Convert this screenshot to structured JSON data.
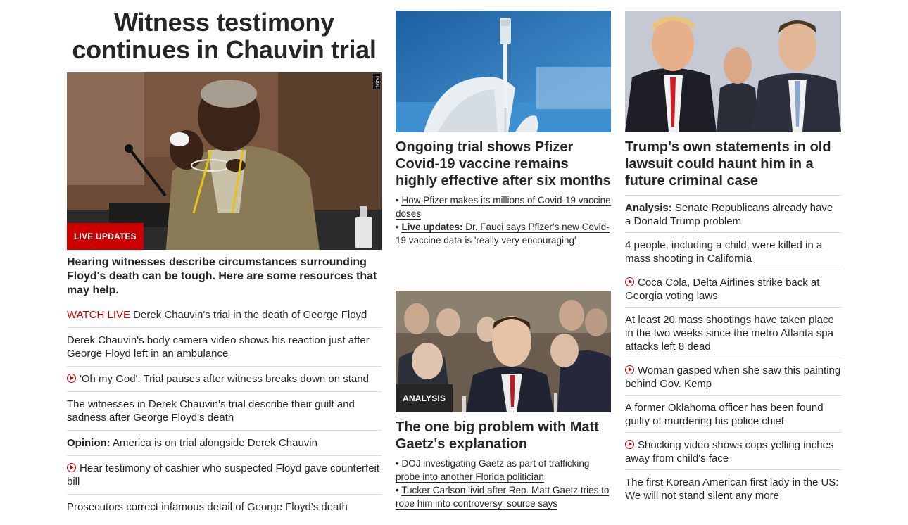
{
  "lead": {
    "title": "Witness testimony continues in Chauvin trial",
    "badge": "LIVE UPDATES",
    "pool_mark": "POOL",
    "subhead": "Hearing witnesses describe circumstances surrounding Floyd's death can be tough. Here are some resources that may help.",
    "items": [
      {
        "prefix": "WATCH LIVE",
        "text": " Derek Chauvin's trial in the death of George Floyd"
      },
      {
        "text": "Derek Chauvin's body camera video shows his reaction just after George Floyd left in an ambulance"
      },
      {
        "video": true,
        "text": "'Oh my God': Trial pauses after witness breaks down on stand"
      },
      {
        "text": "The witnesses in Derek Chauvin's trial describe their guilt and sadness after George Floyd's death"
      },
      {
        "prefix_bold": "Opinion:",
        "text": " America is on trial alongside Derek Chauvin"
      },
      {
        "video": true,
        "text": "Hear testimony of cashier who suspected Floyd gave counterfeit bill"
      },
      {
        "text": "Prosecutors correct infamous detail of George Floyd's death"
      }
    ]
  },
  "pfizer": {
    "headline": "Ongoing trial shows Pfizer Covid-19 vaccine remains highly effective after six months",
    "bullets": [
      {
        "prefix": "• ",
        "text": "How Pfizer makes its millions of Covid-19 vaccine doses"
      },
      {
        "prefix": "• ",
        "bold": "Live updates:",
        "text": " Dr. Fauci says Pfizer's new Covid-19 vaccine data is 'really very encouraging'"
      }
    ]
  },
  "gaetz": {
    "badge": "ANALYSIS",
    "headline": "The one big problem with Matt Gaetz's explanation",
    "bullets": [
      {
        "prefix": "• ",
        "text": "DOJ investigating Gaetz as part of trafficking probe into another Florida politician"
      },
      {
        "prefix": "• ",
        "text": "Tucker Carlson livid after Rep. Matt Gaetz tries to rope him into controversy, source says"
      }
    ]
  },
  "trump": {
    "headline": "Trump's own statements in old lawsuit could haunt him in a future criminal case",
    "items": [
      {
        "prefix_bold": "Analysis:",
        "text": " Senate Republicans already have a Donald Trump problem"
      },
      {
        "text": "4 people, including a child, were killed in a mass shooting in California"
      },
      {
        "video": true,
        "text": "Coca Cola, Delta Airlines strike back at Georgia voting laws"
      },
      {
        "text": "At least 20 mass shootings have taken place in the two weeks since the metro Atlanta spa attacks left 8 dead"
      },
      {
        "video": true,
        "text": "Woman gasped when she saw this painting behind Gov. Kemp"
      },
      {
        "text": "A former Oklahoma officer has been found guilty of murdering his police chief"
      },
      {
        "video": true,
        "text": "Shocking video shows cops yelling inches away from child's face"
      },
      {
        "text": "The first Korean American first lady in the US: We will not stand silent any more"
      }
    ]
  },
  "colors": {
    "accent": "#cc0000",
    "text": "#262626",
    "divider": "#dcdcdc"
  }
}
